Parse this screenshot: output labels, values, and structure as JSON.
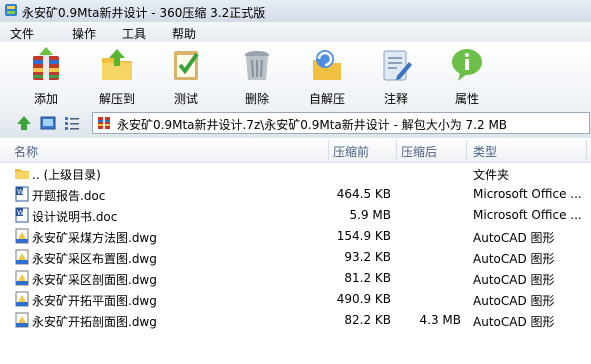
{
  "window": {
    "title": "永安矿0.9Mta新井设计 - 360压缩 3.2正式版"
  },
  "menu": {
    "items": [
      "文件",
      "操作",
      "工具",
      "帮助"
    ]
  },
  "toolbar": {
    "buttons": [
      {
        "label": "添加",
        "icon": "add-archive-icon"
      },
      {
        "label": "解压到",
        "icon": "extract-to-icon"
      },
      {
        "label": "测试",
        "icon": "test-icon"
      },
      {
        "label": "删除",
        "icon": "delete-icon"
      },
      {
        "label": "自解压",
        "icon": "self-extract-icon"
      },
      {
        "label": "注释",
        "icon": "comment-icon"
      },
      {
        "label": "属性",
        "icon": "properties-icon"
      }
    ]
  },
  "address": {
    "path": "永安矿0.9Mta新井设计.7z\\永安矿0.9Mta新井设计 - 解包大小为 7.2 MB"
  },
  "columns": {
    "name": "名称",
    "size": "压缩前",
    "packed": "压缩后",
    "type": "类型"
  },
  "files": [
    {
      "name": ".. (上级目录)",
      "size": "",
      "packed": "",
      "type": "文件夹",
      "icon": "folder-icon"
    },
    {
      "name": "开题报告.doc",
      "size": "464.5 KB",
      "packed": "",
      "type": "Microsoft Office ...",
      "icon": "word-doc-icon"
    },
    {
      "name": "设计说明书.doc",
      "size": "5.9 MB",
      "packed": "",
      "type": "Microsoft Office ...",
      "icon": "word-doc-icon"
    },
    {
      "name": "永安矿采煤方法图.dwg",
      "size": "154.9 KB",
      "packed": "",
      "type": "AutoCAD 图形",
      "icon": "dwg-file-icon"
    },
    {
      "name": "永安矿采区布置图.dwg",
      "size": "93.2 KB",
      "packed": "",
      "type": "AutoCAD 图形",
      "icon": "dwg-file-icon"
    },
    {
      "name": "永安矿采区剖面图.dwg",
      "size": "81.2 KB",
      "packed": "",
      "type": "AutoCAD 图形",
      "icon": "dwg-file-icon"
    },
    {
      "name": "永安矿开拓平面图.dwg",
      "size": "490.9 KB",
      "packed": "",
      "type": "AutoCAD 图形",
      "icon": "dwg-file-icon"
    },
    {
      "name": "永安矿开拓剖面图.dwg",
      "size": "82.2 KB",
      "packed": "4.3 MB",
      "type": "AutoCAD 图形",
      "icon": "dwg-file-icon"
    }
  ]
}
